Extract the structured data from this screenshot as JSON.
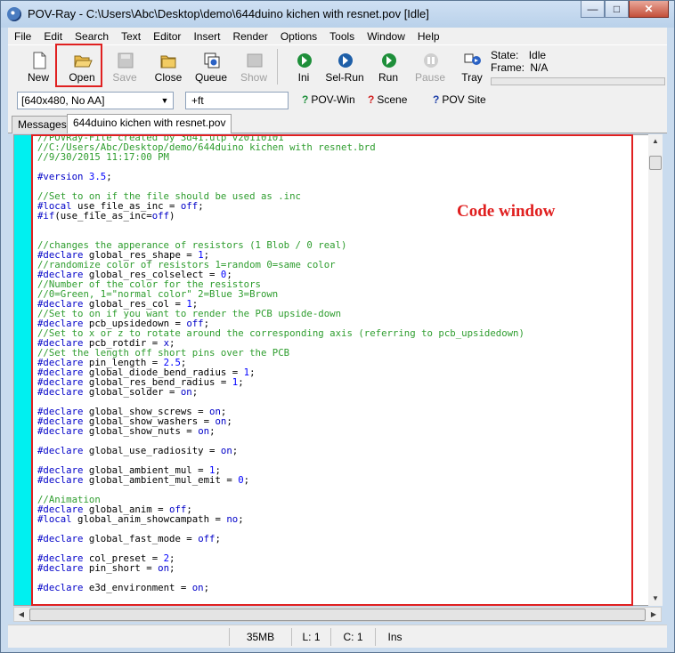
{
  "window": {
    "title": "POV-Ray - C:\\Users\\Abc\\Desktop\\demo\\644duino kichen with resnet.pov [Idle]",
    "controls": {
      "minimize": "—",
      "maximize": "□",
      "close": "✕"
    }
  },
  "menu": [
    "File",
    "Edit",
    "Search",
    "Text",
    "Editor",
    "Insert",
    "Render",
    "Options",
    "Tools",
    "Window",
    "Help"
  ],
  "toolbar": {
    "buttons": [
      {
        "label": "New",
        "icon": "new-document-icon",
        "enabled": true
      },
      {
        "label": "Open",
        "icon": "open-folder-icon",
        "enabled": true
      },
      {
        "label": "Save",
        "icon": "save-icon",
        "enabled": false
      },
      {
        "label": "Close",
        "icon": "close-folder-icon",
        "enabled": true
      },
      {
        "label": "Queue",
        "icon": "queue-icon",
        "enabled": true
      },
      {
        "label": "Show",
        "icon": "show-icon",
        "enabled": false
      },
      {
        "label": "Ini",
        "icon": "ini-icon",
        "enabled": true
      },
      {
        "label": "Sel-Run",
        "icon": "sel-run-icon",
        "enabled": true
      },
      {
        "label": "Run",
        "icon": "run-icon",
        "enabled": true
      },
      {
        "label": "Pause",
        "icon": "pause-icon",
        "enabled": false
      },
      {
        "label": "Tray",
        "icon": "tray-icon",
        "enabled": true
      }
    ],
    "state_label": "State:",
    "state_value": "Idle",
    "frame_label": "Frame:",
    "frame_value": "N/A"
  },
  "toolbar2": {
    "resolution": "[640x480, No AA]",
    "command_line": "+ft",
    "links": [
      "POV-Win",
      "Scene",
      "POV Site"
    ]
  },
  "tabs": [
    "Messages",
    "644duino kichen with resnet.pov"
  ],
  "annotation": "Code window",
  "code": [
    [
      [
        "c",
        "//POVRay-File created by 3d41.ulp v20110101"
      ]
    ],
    [
      [
        "c",
        "//C:/Users/Abc/Desktop/demo/644duino kichen with resnet.brd"
      ]
    ],
    [
      [
        "c",
        "//9/30/2015 11:17:00 PM"
      ]
    ],
    [],
    [
      [
        "p",
        "#version "
      ],
      [
        "num",
        "3.5"
      ],
      [
        "n",
        ";"
      ]
    ],
    [],
    [
      [
        "c",
        "//Set to on if the file should be used as .inc"
      ]
    ],
    [
      [
        "p",
        "#local "
      ],
      [
        "n",
        "use_file_as_inc = "
      ],
      [
        "k",
        "off"
      ],
      [
        "n",
        ";"
      ]
    ],
    [
      [
        "p",
        "#if"
      ],
      [
        "n",
        "(use_file_as_inc="
      ],
      [
        "k",
        "off"
      ],
      [
        "n",
        ")"
      ]
    ],
    [],
    [],
    [
      [
        "c",
        "//changes the apperance of resistors (1 Blob / 0 real)"
      ]
    ],
    [
      [
        "p",
        "#declare "
      ],
      [
        "n",
        "global_res_shape = "
      ],
      [
        "num",
        "1"
      ],
      [
        "n",
        ";"
      ]
    ],
    [
      [
        "c",
        "//randomize color of resistors 1=random 0=same color"
      ]
    ],
    [
      [
        "p",
        "#declare "
      ],
      [
        "n",
        "global_res_colselect = "
      ],
      [
        "num",
        "0"
      ],
      [
        "n",
        ";"
      ]
    ],
    [
      [
        "c",
        "//Number of the color for the resistors"
      ]
    ],
    [
      [
        "c",
        "//0=Green, 1=\"normal color\" 2=Blue 3=Brown"
      ]
    ],
    [
      [
        "p",
        "#declare "
      ],
      [
        "n",
        "global_res_col = "
      ],
      [
        "num",
        "1"
      ],
      [
        "n",
        ";"
      ]
    ],
    [
      [
        "c",
        "//Set to on if you want to render the PCB upside-down"
      ]
    ],
    [
      [
        "p",
        "#declare "
      ],
      [
        "n",
        "pcb_upsidedown = "
      ],
      [
        "k",
        "off"
      ],
      [
        "n",
        ";"
      ]
    ],
    [
      [
        "c",
        "//Set to x or z to rotate around the corresponding axis (referring to pcb_upsidedown)"
      ]
    ],
    [
      [
        "p",
        "#declare "
      ],
      [
        "n",
        "pcb_rotdir = "
      ],
      [
        "k",
        "x"
      ],
      [
        "n",
        ";"
      ]
    ],
    [
      [
        "c",
        "//Set the length off short pins over the PCB"
      ]
    ],
    [
      [
        "p",
        "#declare "
      ],
      [
        "n",
        "pin_length = "
      ],
      [
        "num",
        "2.5"
      ],
      [
        "n",
        ";"
      ]
    ],
    [
      [
        "p",
        "#declare "
      ],
      [
        "n",
        "global_diode_bend_radius = "
      ],
      [
        "num",
        "1"
      ],
      [
        "n",
        ";"
      ]
    ],
    [
      [
        "p",
        "#declare "
      ],
      [
        "n",
        "global_res_bend_radius = "
      ],
      [
        "num",
        "1"
      ],
      [
        "n",
        ";"
      ]
    ],
    [
      [
        "p",
        "#declare "
      ],
      [
        "n",
        "global_solder = "
      ],
      [
        "k",
        "on"
      ],
      [
        "n",
        ";"
      ]
    ],
    [],
    [
      [
        "p",
        "#declare "
      ],
      [
        "n",
        "global_show_screws = "
      ],
      [
        "k",
        "on"
      ],
      [
        "n",
        ";"
      ]
    ],
    [
      [
        "p",
        "#declare "
      ],
      [
        "n",
        "global_show_washers = "
      ],
      [
        "k",
        "on"
      ],
      [
        "n",
        ";"
      ]
    ],
    [
      [
        "p",
        "#declare "
      ],
      [
        "n",
        "global_show_nuts = "
      ],
      [
        "k",
        "on"
      ],
      [
        "n",
        ";"
      ]
    ],
    [],
    [
      [
        "p",
        "#declare "
      ],
      [
        "n",
        "global_use_radiosity = "
      ],
      [
        "k",
        "on"
      ],
      [
        "n",
        ";"
      ]
    ],
    [],
    [
      [
        "p",
        "#declare "
      ],
      [
        "n",
        "global_ambient_mul = "
      ],
      [
        "num",
        "1"
      ],
      [
        "n",
        ";"
      ]
    ],
    [
      [
        "p",
        "#declare "
      ],
      [
        "n",
        "global_ambient_mul_emit = "
      ],
      [
        "num",
        "0"
      ],
      [
        "n",
        ";"
      ]
    ],
    [],
    [
      [
        "c",
        "//Animation"
      ]
    ],
    [
      [
        "p",
        "#declare "
      ],
      [
        "n",
        "global_anim = "
      ],
      [
        "k",
        "off"
      ],
      [
        "n",
        ";"
      ]
    ],
    [
      [
        "p",
        "#local "
      ],
      [
        "n",
        "global_anim_showcampath = "
      ],
      [
        "k",
        "no"
      ],
      [
        "n",
        ";"
      ]
    ],
    [],
    [
      [
        "p",
        "#declare "
      ],
      [
        "n",
        "global_fast_mode = "
      ],
      [
        "k",
        "off"
      ],
      [
        "n",
        ";"
      ]
    ],
    [],
    [
      [
        "p",
        "#declare "
      ],
      [
        "n",
        "col_preset = "
      ],
      [
        "num",
        "2"
      ],
      [
        "n",
        ";"
      ]
    ],
    [
      [
        "p",
        "#declare "
      ],
      [
        "n",
        "pin_short = "
      ],
      [
        "k",
        "on"
      ],
      [
        "n",
        ";"
      ]
    ],
    [],
    [
      [
        "p",
        "#declare "
      ],
      [
        "n",
        "e3d_environment = "
      ],
      [
        "k",
        "on"
      ],
      [
        "n",
        ";"
      ]
    ]
  ],
  "statusbar": {
    "memory": "35MB",
    "line": "L: 1",
    "col": "C: 1",
    "mode": "Ins"
  },
  "colors": {
    "annotation": "#e02020",
    "gutter": "#00f0f0",
    "comment": "#2e9d2e",
    "directive": "#0000c8"
  }
}
